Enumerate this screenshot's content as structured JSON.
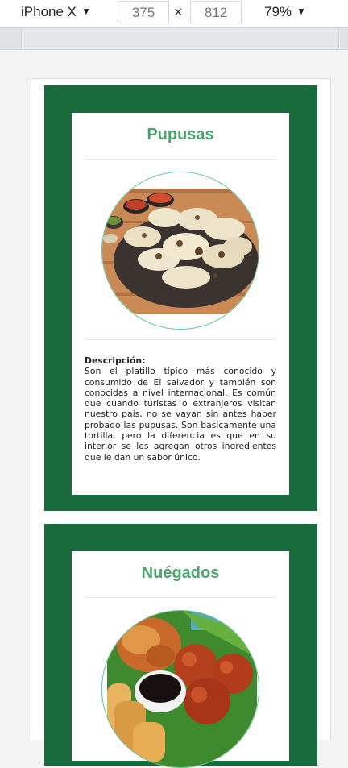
{
  "toolbar": {
    "device": "iPhone X",
    "width": "375",
    "times": "×",
    "height": "812",
    "zoom": "79%"
  },
  "cards": [
    {
      "title": "Pupusas",
      "desc_label": "Descripción:",
      "desc_text": "Son el platillo típico más conocido y consumido de El salvador y también son conocidas a nivel internacional. Es común que cuando turistas o extranjeros visitan nuestro país, no se vayan sin antes haber probado las pupusas. Son básicamente una tortilla, pero la diferencia es que en su interior se les agregan otros ingredientes que le dan un sabor único."
    },
    {
      "title": "Nuégados"
    }
  ],
  "colors": {
    "card_border": "#1a6b3c",
    "title_green": "#4aa56a",
    "circle_outline": "#5cc08a"
  }
}
